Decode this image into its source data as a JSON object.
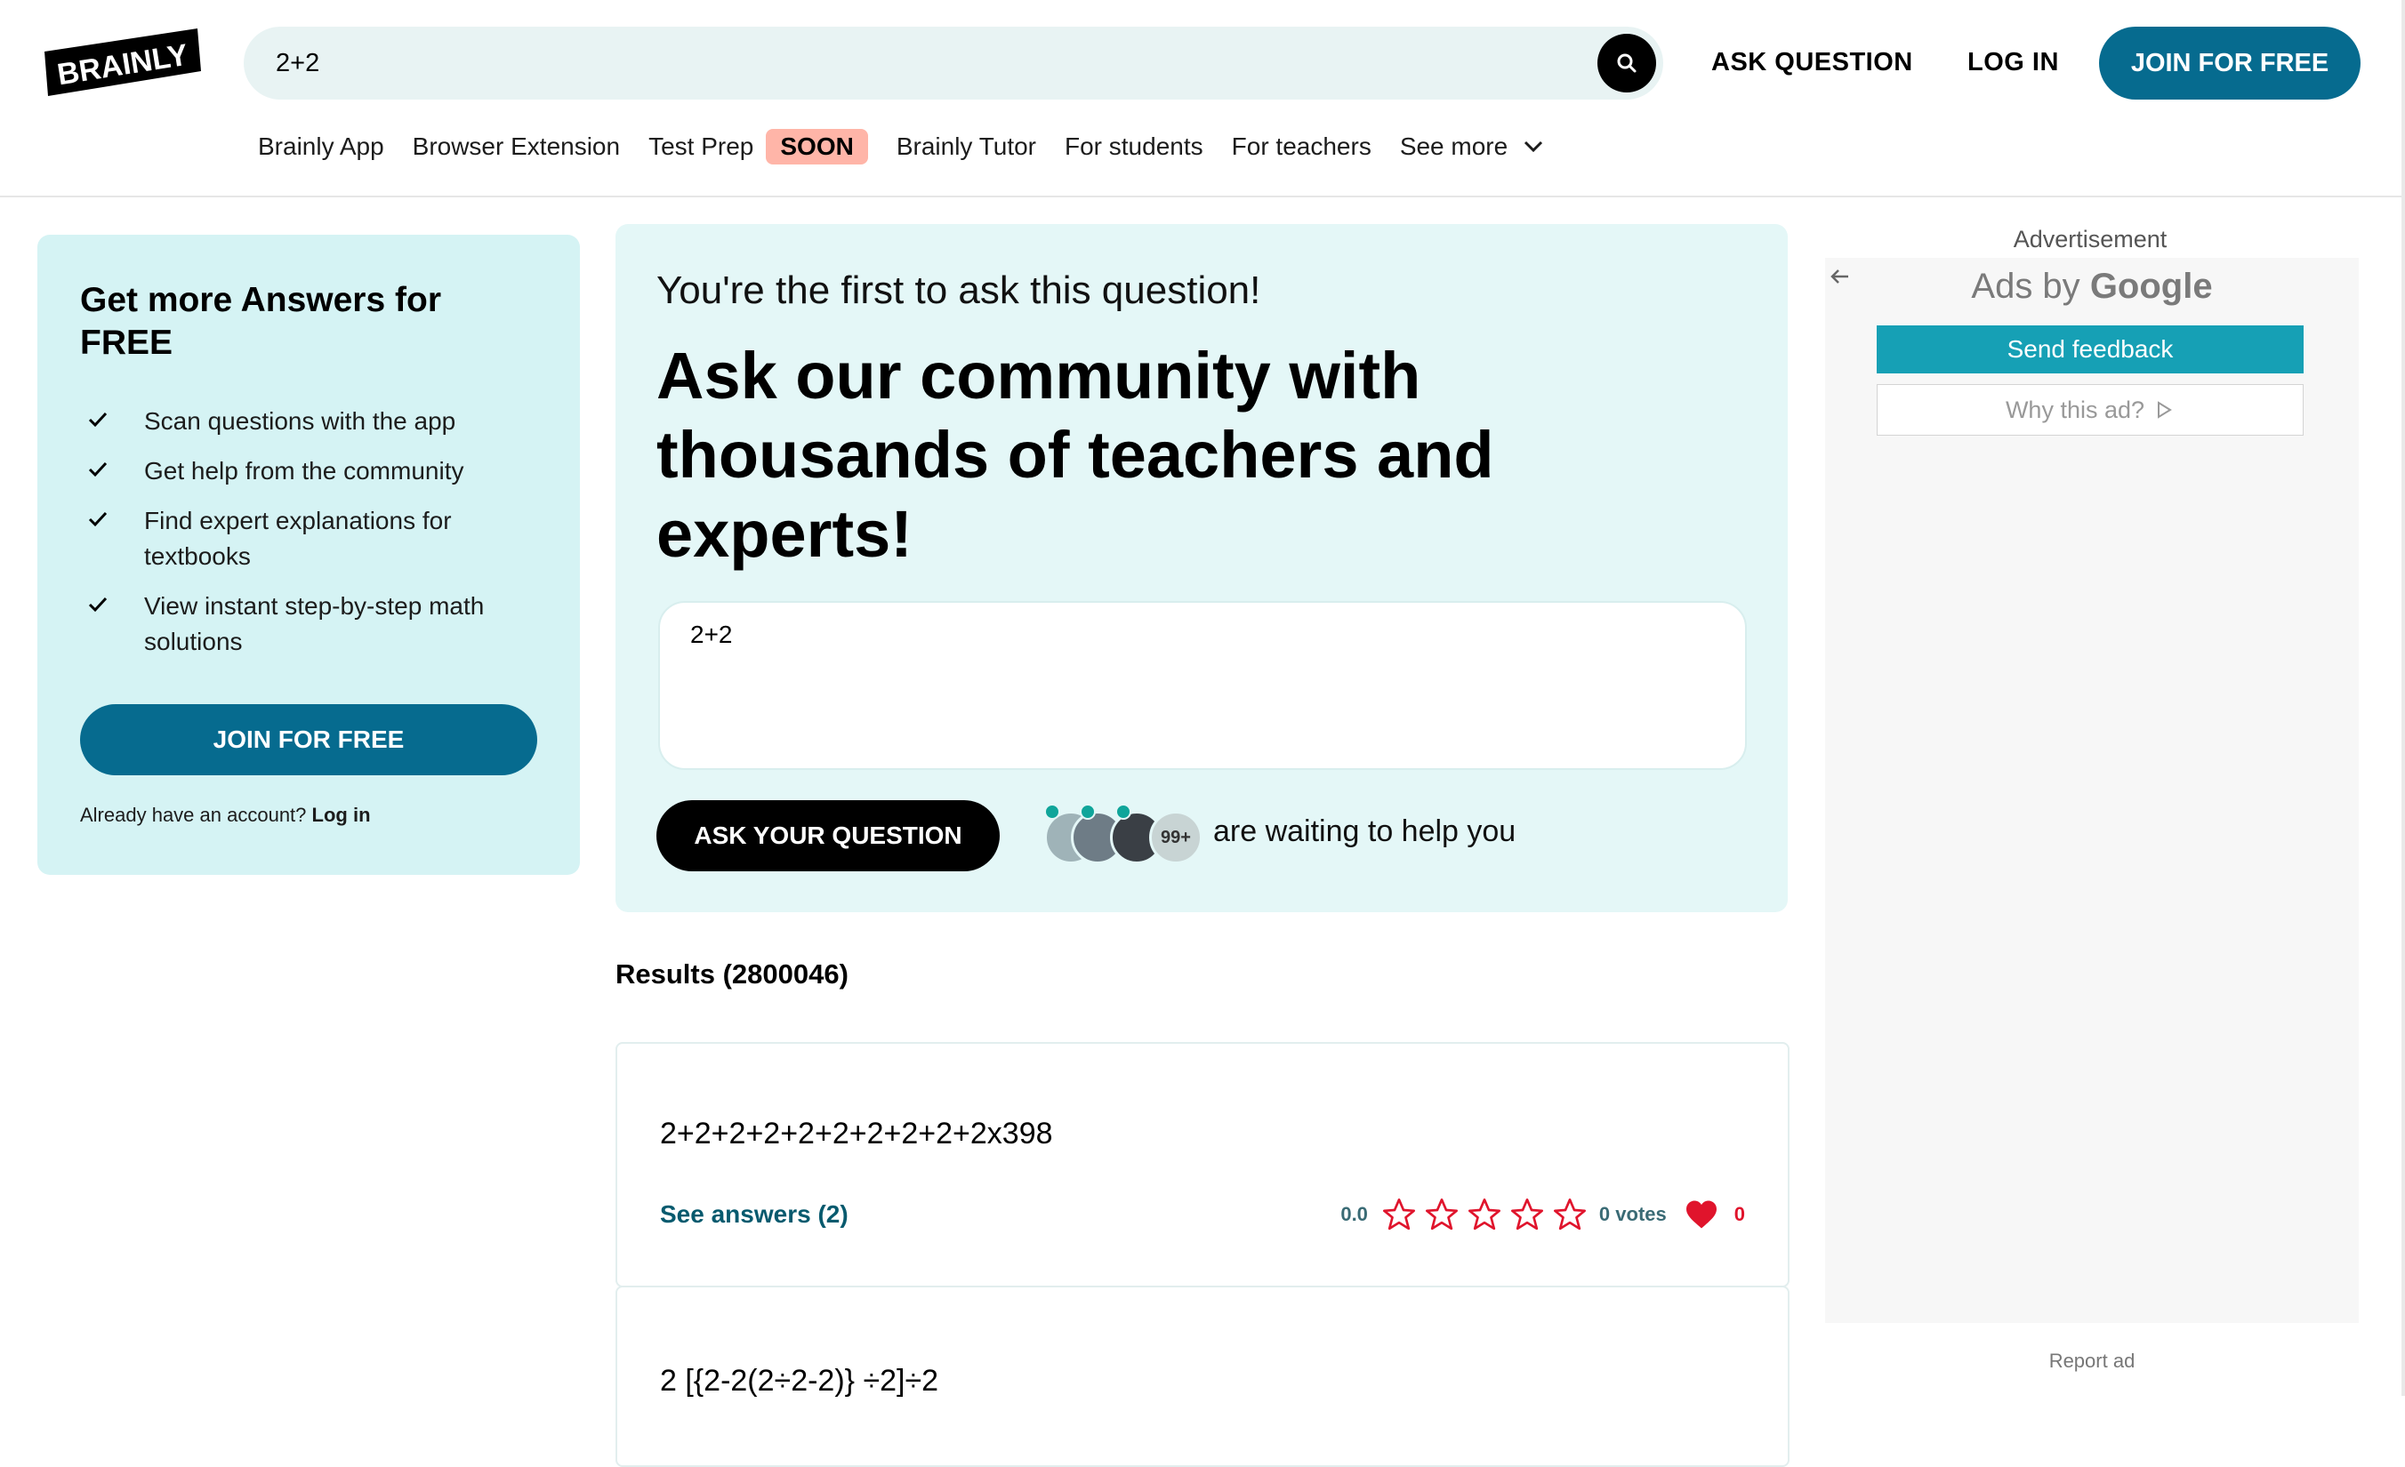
{
  "header": {
    "logo_text": "BRAINLY",
    "search_value": "2+2",
    "ask_question": "ASK QUESTION",
    "log_in": "LOG IN",
    "join": "JOIN FOR FREE"
  },
  "nav": {
    "items": [
      "Brainly App",
      "Browser Extension",
      "Test Prep",
      "Brainly Tutor",
      "For students",
      "For teachers",
      "See more"
    ],
    "soon_badge": "SOON"
  },
  "promo": {
    "title": "Get more Answers for FREE",
    "features": [
      "Scan questions with the app",
      "Get help from the community",
      "Find expert explanations for textbooks",
      "View instant step-by-step math solutions"
    ],
    "join": "JOIN FOR FREE",
    "already": "Already have an account?",
    "login": "Log in"
  },
  "ask": {
    "subtitle": "You're the first to ask this question!",
    "title": "Ask our community with thousands of teachers and experts!",
    "input_value": "2+2",
    "button": "ASK YOUR QUESTION",
    "helpers_count": "99+",
    "waiting": "are waiting to help you"
  },
  "results": {
    "label": "Results (2800046)",
    "items": [
      {
        "question": "2+2+2+2+2+2+2+2+2+2x398",
        "see_answers": "See answers (2)",
        "rating": "0.0",
        "stars": 0,
        "votes": "0 votes",
        "likes": "0"
      },
      {
        "question": "2 [{2-2(2÷2-2)} ÷2]÷2"
      }
    ]
  },
  "ad": {
    "label": "Advertisement",
    "ads_by": "Ads by",
    "google": "Google",
    "send_feedback": "Send feedback",
    "why_this_ad": "Why this ad?",
    "report": "Report ad"
  },
  "colors": {
    "brand_blue": "#066b8f",
    "promo_bg": "#d5f3f4",
    "ask_bg": "#e4f7f7",
    "soon_bg": "#ffb5a8",
    "star": "#e0142c",
    "feedback": "#16a0b5"
  },
  "icons": [
    "brainly-logo",
    "search-icon",
    "chevron-down-icon",
    "check-icon",
    "star-icon",
    "heart-icon",
    "back-arrow-icon",
    "play-icon"
  ]
}
